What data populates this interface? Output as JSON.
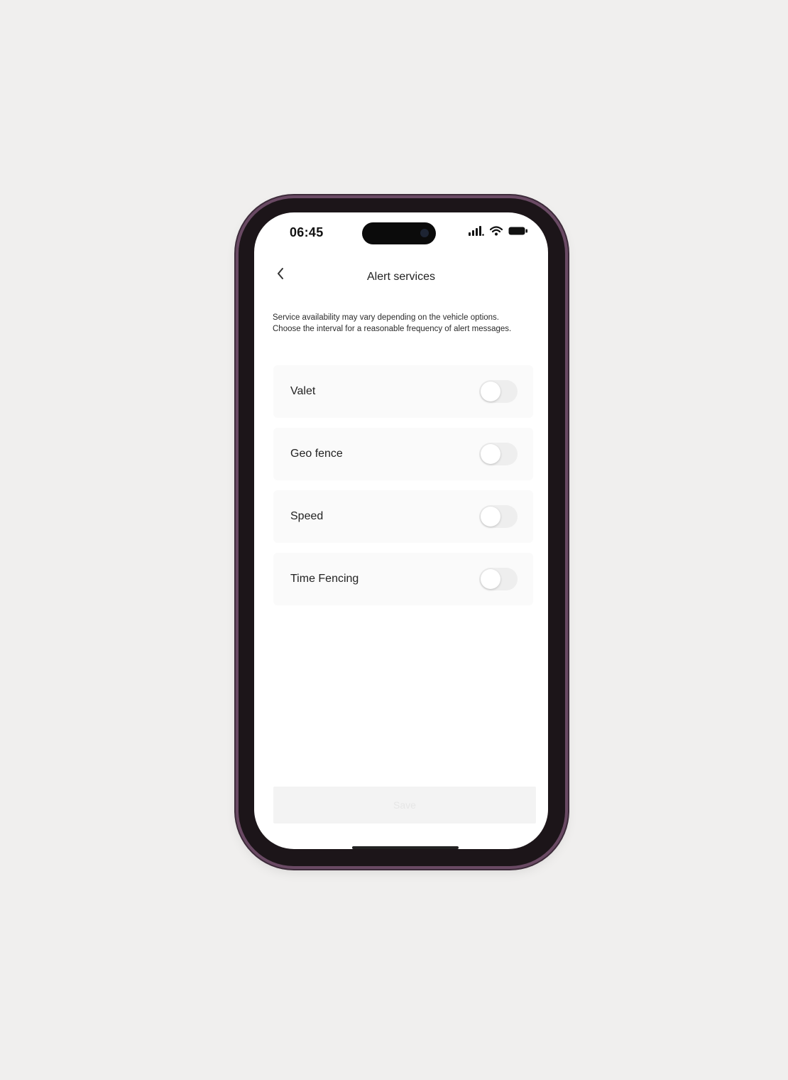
{
  "status_bar": {
    "time": "06:45",
    "icons": [
      "signal-icon",
      "wifi-icon",
      "battery-icon"
    ]
  },
  "header": {
    "title": "Alert services",
    "back_icon": "chevron-left-icon"
  },
  "description": {
    "line1": "Service availability may vary depending on the vehicle options.",
    "line2": "Choose the interval for a reasonable frequency of alert messages."
  },
  "services": [
    {
      "label": "Valet",
      "enabled": false
    },
    {
      "label": "Geo fence",
      "enabled": false
    },
    {
      "label": "Speed",
      "enabled": false
    },
    {
      "label": "Time Fencing",
      "enabled": false
    }
  ],
  "footer": {
    "save_label": "Save",
    "save_enabled": false
  },
  "colors": {
    "background": "#f0efee",
    "phone_frame": "#6a4a64",
    "screen": "#ffffff",
    "row_background": "#fafafa",
    "toggle_off": "#eeeeee"
  }
}
